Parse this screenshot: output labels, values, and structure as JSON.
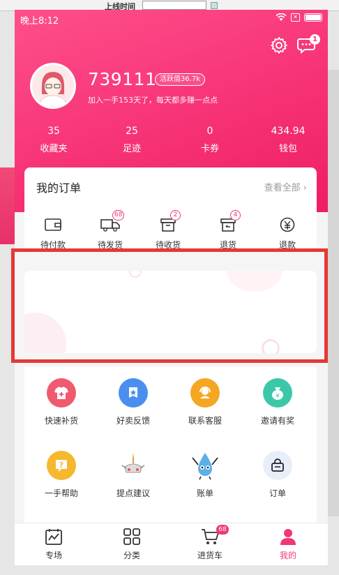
{
  "background": {
    "topbar_label": "上线时间"
  },
  "status_bar": {
    "time": "晚上8:12",
    "sim_label": "✕"
  },
  "header": {
    "message_badge": "1",
    "username": "739111",
    "active_badge": "活跃值36.7k",
    "slogan": "加入一手153天了，每天都多赚一点点"
  },
  "stats": [
    {
      "value": "35",
      "label": "收藏夹"
    },
    {
      "value": "25",
      "label": "足迹"
    },
    {
      "value": "0",
      "label": "卡券"
    },
    {
      "value": "434.94",
      "label": "钱包"
    }
  ],
  "orders": {
    "title": "我的订单",
    "view_all": "查看全部",
    "chevron": "›",
    "items": [
      {
        "label": "待付款",
        "badge": "",
        "icon": "wallet-icon"
      },
      {
        "label": "待发货",
        "badge": "68",
        "icon": "truck-icon"
      },
      {
        "label": "待收货",
        "badge": "2",
        "icon": "box-icon"
      },
      {
        "label": "退货",
        "badge": "4",
        "icon": "return-icon"
      },
      {
        "label": "退款",
        "badge": "",
        "icon": "refund-icon"
      }
    ]
  },
  "services": [
    {
      "label": "快速补货",
      "icon": "shirt-plus-icon",
      "color": "#f05a6e"
    },
    {
      "label": "好卖反馈",
      "icon": "star-badge-icon",
      "color": "#4a8ff0"
    },
    {
      "label": "联系客服",
      "icon": "headset-icon",
      "color": "#f5a623"
    },
    {
      "label": "邀请有奖",
      "icon": "money-bag-icon",
      "color": "#3cc8a8"
    },
    {
      "label": "一手帮助",
      "icon": "question-icon",
      "color": "#f5b82e"
    },
    {
      "label": "提点建议",
      "icon": "birthday-cake-icon",
      "color": "#ffffff"
    },
    {
      "label": "账单",
      "icon": "water-drop-mascot-icon",
      "color": "#ffffff"
    },
    {
      "label": "订单",
      "icon": "order-bag-icon",
      "color": "#e8eef8"
    }
  ],
  "bottom_nav": [
    {
      "label": "专场",
      "icon": "calendar-chart-icon"
    },
    {
      "label": "分类",
      "icon": "grid-icon"
    },
    {
      "label": "进货车",
      "icon": "cart-icon",
      "badge": "68"
    },
    {
      "label": "我的",
      "icon": "person-icon"
    }
  ],
  "colors": {
    "brand": "#f03872",
    "highlight": "#e53935"
  }
}
